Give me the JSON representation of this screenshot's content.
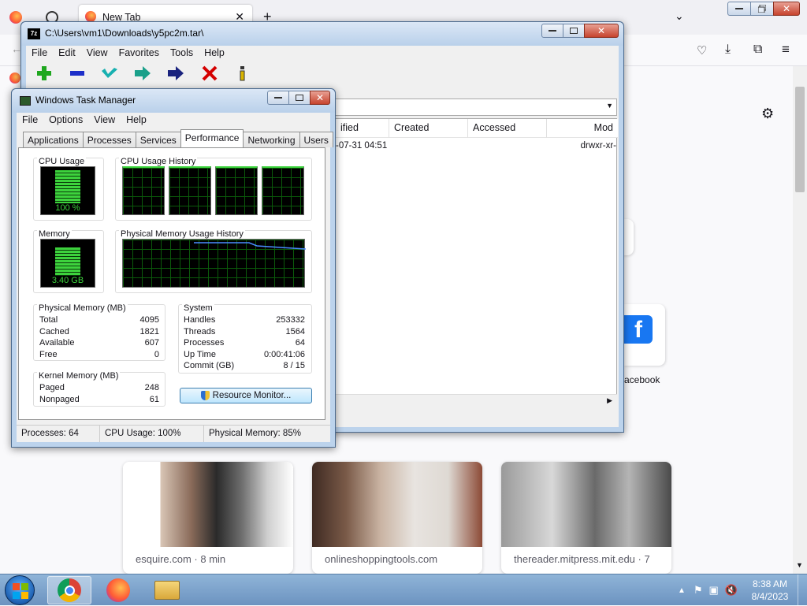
{
  "firefox": {
    "tab_title": "New Tab",
    "stories": [
      {
        "source": "esquire.com · 8 min"
      },
      {
        "source": "onlineshoppingtools.com"
      },
      {
        "source": "thereader.mitpress.mit.edu · 7"
      }
    ],
    "shortcut_label": "acebook"
  },
  "zip": {
    "title": "C:\\Users\\vm1\\Downloads\\y5pc2m.tar\\",
    "menu": [
      "File",
      "Edit",
      "View",
      "Favorites",
      "Tools",
      "Help"
    ],
    "toolbar": [
      "Add",
      "Extract",
      "Test",
      "Copy",
      "Move",
      "Delete",
      "Info"
    ],
    "columns": [
      "ified",
      "Created",
      "Accessed",
      "Mod"
    ],
    "row": {
      "modified": "-07-31 04:51",
      "attr": "drwxr-xr-"
    }
  },
  "taskmgr": {
    "title": "Windows Task Manager",
    "menu": [
      "File",
      "Options",
      "View",
      "Help"
    ],
    "tabs": [
      "Applications",
      "Processes",
      "Services",
      "Performance",
      "Networking",
      "Users"
    ],
    "active_tab": "Performance",
    "cpu_usage_label": "CPU Usage",
    "cpu_usage_value": "100 %",
    "cpu_history_label": "CPU Usage History",
    "memory_label": "Memory",
    "memory_value": "3.40 GB",
    "phys_history_label": "Physical Memory Usage History",
    "physical_memory": {
      "title": "Physical Memory (MB)",
      "rows": [
        {
          "label": "Total",
          "value": "4095"
        },
        {
          "label": "Cached",
          "value": "1821"
        },
        {
          "label": "Available",
          "value": "607"
        },
        {
          "label": "Free",
          "value": "0"
        }
      ]
    },
    "system": {
      "title": "System",
      "rows": [
        {
          "label": "Handles",
          "value": "253332"
        },
        {
          "label": "Threads",
          "value": "1564"
        },
        {
          "label": "Processes",
          "value": "64"
        },
        {
          "label": "Up Time",
          "value": "0:00:41:06"
        },
        {
          "label": "Commit (GB)",
          "value": "8 / 15"
        }
      ]
    },
    "kernel_memory": {
      "title": "Kernel Memory (MB)",
      "rows": [
        {
          "label": "Paged",
          "value": "248"
        },
        {
          "label": "Nonpaged",
          "value": "61"
        }
      ]
    },
    "resource_monitor_button": "Resource Monitor...",
    "status": {
      "processes": "Processes: 64",
      "cpu": "CPU Usage: 100%",
      "memory": "Physical Memory: 85%"
    }
  },
  "taskbar": {
    "time": "8:38 AM",
    "date": "8/4/2023"
  }
}
